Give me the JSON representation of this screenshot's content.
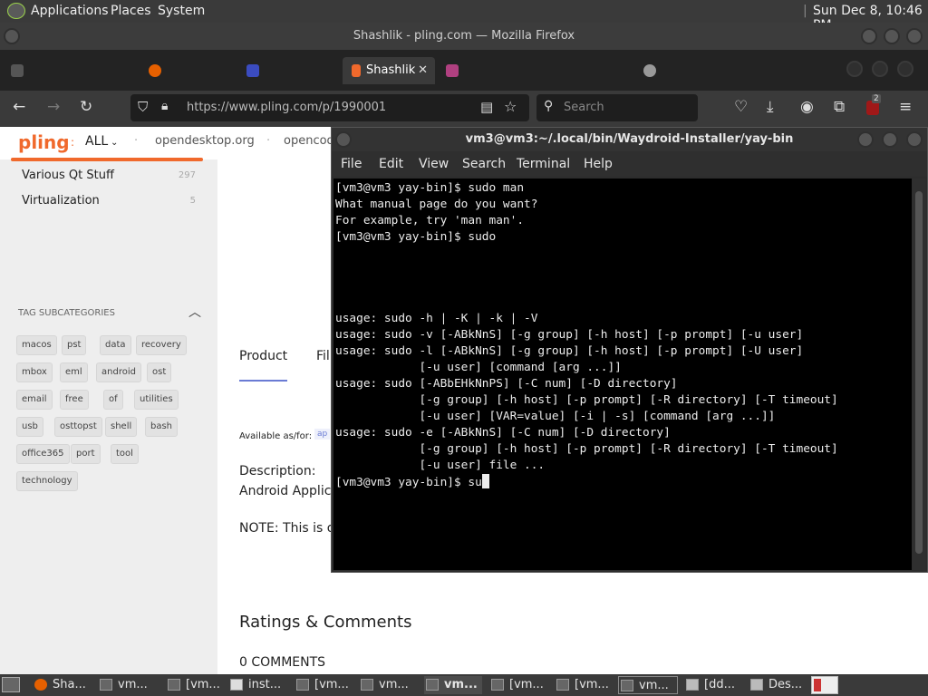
{
  "top_panel": {
    "menus": [
      "Applications",
      "Places",
      "System"
    ],
    "clock": "Sun Dec 8, 10:46 PM"
  },
  "firefox": {
    "title": "Shashlik - pling.com — Mozilla Firefox",
    "active_tab": "Shashlik",
    "url": "https://www.pling.com/p/1990001",
    "search_placeholder": "Search",
    "badge_count": "2"
  },
  "page": {
    "nav": {
      "logo": "pling",
      "all_label": "ALL",
      "links": [
        "opendesktop.org",
        "opencod"
      ]
    },
    "categories": [
      {
        "label": "Various Qt Stuff",
        "count": "297"
      },
      {
        "label": "Virtualization",
        "count": "5"
      }
    ],
    "tag_heading": "TAG SUBCATEGORIES",
    "tags": [
      "macos",
      "pst",
      "data",
      "recovery",
      "mbox",
      "eml",
      "android",
      "ost",
      "email",
      "free",
      "of",
      "utilities",
      "usb",
      "osttopst",
      "shell",
      "bash",
      "office365",
      "port",
      "tool",
      "technology"
    ],
    "tabs": {
      "product": "Product",
      "files": "Fil"
    },
    "available_label": "Available as/for:",
    "available_chip": "ap",
    "description_heading": "Description:",
    "description_text": "Android Applica",
    "note_text": "NOTE: This is or",
    "ratings_heading": "Ratings & Comments",
    "comments_count": "0 COMMENTS"
  },
  "terminal": {
    "title": "vm3@vm3:~/.local/bin/Waydroid-Installer/yay-bin",
    "menus": [
      "File",
      "Edit",
      "View",
      "Search",
      "Terminal",
      "Help"
    ],
    "lines": [
      "[vm3@vm3 yay-bin]$ sudo man",
      "What manual page do you want?",
      "For example, try 'man man'.",
      "[vm3@vm3 yay-bin]$ sudo",
      "",
      "",
      "",
      "",
      "usage: sudo -h | -K | -k | -V",
      "usage: sudo -v [-ABkNnS] [-g group] [-h host] [-p prompt] [-u user]",
      "usage: sudo -l [-ABkNnS] [-g group] [-h host] [-p prompt] [-U user]",
      "            [-u user] [command [arg ...]]",
      "usage: sudo [-ABbEHkNnPS] [-C num] [-D directory]",
      "            [-g group] [-h host] [-p prompt] [-R directory] [-T timeout]",
      "            [-u user] [VAR=value] [-i | -s] [command [arg ...]]",
      "usage: sudo -e [-ABkNnS] [-C num] [-D directory]",
      "            [-g group] [-h host] [-p prompt] [-R directory] [-T timeout]",
      "            [-u user] file ...",
      "[vm3@vm3 yay-bin]$ su"
    ]
  },
  "taskbar": {
    "tasks": [
      "Sha...",
      "vm...",
      "[vm...",
      "inst...",
      "[vm...",
      "vm...",
      "vm...",
      "[vm...",
      "[vm...",
      "vm...",
      "[dd...",
      "Des..."
    ]
  },
  "colors": {
    "pling_orange": "#f0692c",
    "panel": "#3a3a3a",
    "terminal_bg": "#000000",
    "terminal_fg": "#ececec"
  },
  "icons": [
    "app-logo-icon",
    "back-icon",
    "forward-icon",
    "reload-icon",
    "shield-icon",
    "lock-icon",
    "reader-icon",
    "bookmark-star-icon",
    "search-icon",
    "pocket-icon",
    "download-icon",
    "account-icon",
    "extensions-icon",
    "ublock-icon",
    "menu-icon",
    "chevron-up-icon"
  ]
}
